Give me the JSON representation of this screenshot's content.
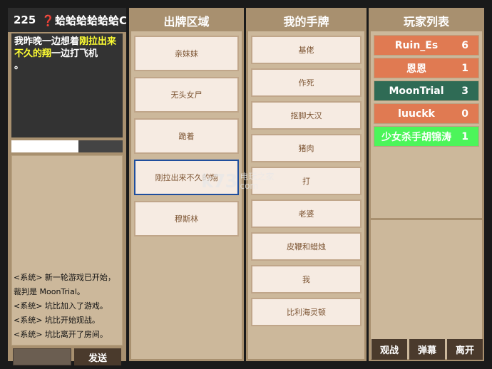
{
  "header": {
    "count": "225",
    "question_title": "❓蛤蛤蛤蛤蛤蛤C",
    "play_area_title": "出牌区域",
    "hand_title": "我的手牌",
    "players_title": "玩家列表"
  },
  "question": {
    "part1": "我昨晚一边想着",
    "highlight": "刚拉出来不久的翔",
    "part2": "一边打飞机",
    "part3": "。"
  },
  "timer_progress": 0.6,
  "chat": {
    "lines": [
      "<系统> 新一轮游戏已开始，",
      "裁判是 MoonTrial。",
      "<系统> 坑比加入了游戏。",
      "<系统> 坑比开始观战。",
      "<系统> 坑比离开了房间。"
    ],
    "send_label": "发送"
  },
  "played_cards": [
    "亲妹妹",
    "无头女尸",
    "跪着",
    "刚拉出来不久的翔",
    "穆斯林"
  ],
  "selected_played_index": 3,
  "hand_cards": [
    "基佬",
    "作死",
    "抠脚大汉",
    "猪肉",
    "打",
    "老婆",
    "皮鞭和蜡烛",
    "我",
    "比利海灵顿"
  ],
  "players": [
    {
      "name": "Ruin_Es",
      "score": "6",
      "color": "#e07a52"
    },
    {
      "name": "恩恩",
      "score": "1",
      "color": "#e07a52"
    },
    {
      "name": "MoonTrial",
      "score": "3",
      "color": "#2f6b55"
    },
    {
      "name": "luuckk",
      "score": "0",
      "color": "#e07a52"
    },
    {
      "name": "少女杀手胡锦涛",
      "score": "1",
      "color": "#4cf55a"
    }
  ],
  "buttons": {
    "watch": "观战",
    "danmaku": "弹幕",
    "leave": "离开"
  },
  "watermark": {
    "logo": "k73",
    "site_cn": "电玩之家",
    "site_url": "com"
  }
}
